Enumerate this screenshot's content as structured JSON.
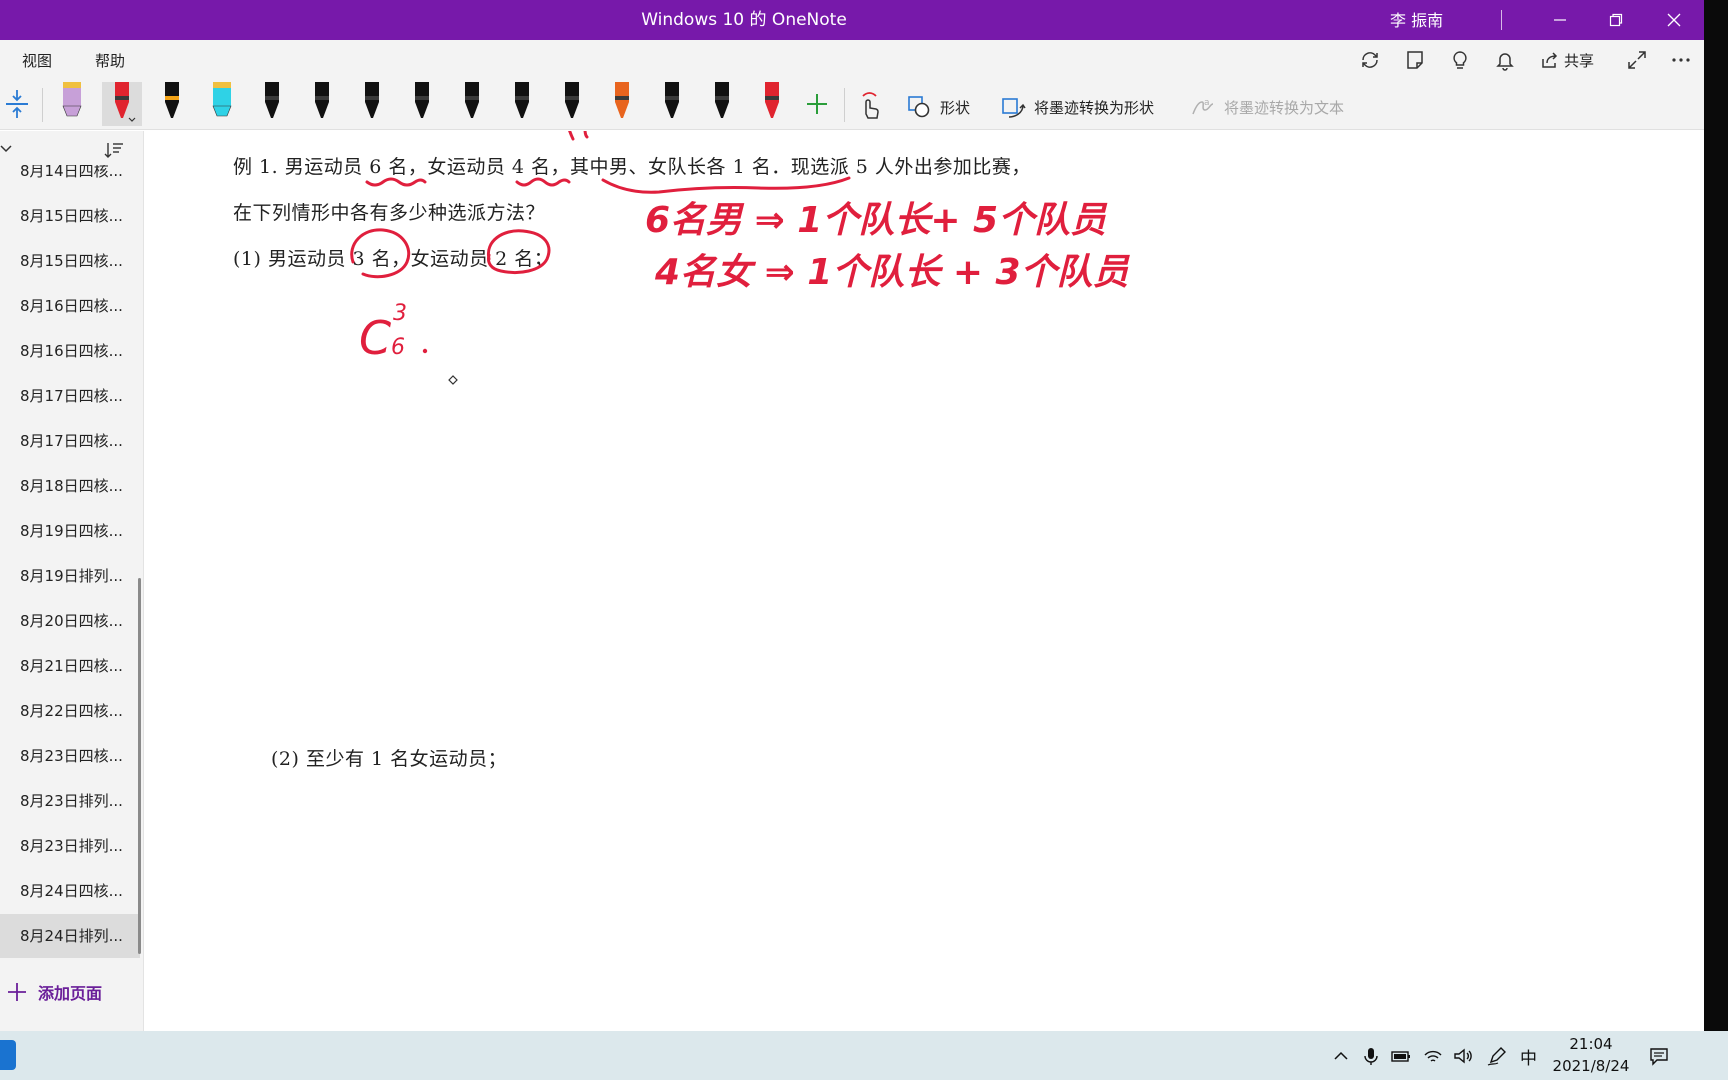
{
  "window": {
    "title": "Windows 10 的 OneNote",
    "user": "李 振南"
  },
  "menu": {
    "items": [
      "视图",
      "帮助"
    ],
    "share_label": "共享"
  },
  "toolbar": {
    "shapes_label": "形状",
    "ink_to_shape_label": "将墨迹转换为形状",
    "ink_to_text_label": "将墨迹转换为文本",
    "pens": [
      {
        "name": "highlighter-lavender",
        "color": "#c7a0d8"
      },
      {
        "name": "pen-red",
        "color": "#e0242f",
        "selected": true
      },
      {
        "name": "pen-black-rainbow",
        "color": "#111111"
      },
      {
        "name": "highlighter-cyan",
        "color": "#2fd2e6"
      },
      {
        "name": "pen-black-blue",
        "color": "#111111"
      },
      {
        "name": "pen-black-green",
        "color": "#111111"
      },
      {
        "name": "pen-black-orange",
        "color": "#111111"
      },
      {
        "name": "pen-black-lightblue",
        "color": "#111111"
      },
      {
        "name": "pen-black-1",
        "color": "#111111"
      },
      {
        "name": "pen-black-2",
        "color": "#111111"
      },
      {
        "name": "pen-black-3",
        "color": "#111111"
      },
      {
        "name": "pen-black-orange-galaxy",
        "color": "#e8641e"
      },
      {
        "name": "pen-black-4",
        "color": "#111111"
      },
      {
        "name": "pen-black-5",
        "color": "#111111"
      },
      {
        "name": "pen-red-2",
        "color": "#e0242f"
      }
    ]
  },
  "sidebar": {
    "pages": [
      {
        "label": "8月14日四核..."
      },
      {
        "label": "8月15日四核..."
      },
      {
        "label": "8月15日四核..."
      },
      {
        "label": "8月16日四核..."
      },
      {
        "label": "8月16日四核..."
      },
      {
        "label": "8月17日四核..."
      },
      {
        "label": "8月17日四核..."
      },
      {
        "label": "8月18日四核..."
      },
      {
        "label": "8月19日四核..."
      },
      {
        "label": "8月19日排列..."
      },
      {
        "label": "8月20日四核..."
      },
      {
        "label": "8月21日四核..."
      },
      {
        "label": "8月22日四核..."
      },
      {
        "label": "8月23日四核..."
      },
      {
        "label": "8月23日排列..."
      },
      {
        "label": "8月23日排列..."
      },
      {
        "label": "8月24日四核..."
      },
      {
        "label": "8月24日排列...",
        "selected": true
      }
    ],
    "add_page_label": "添加页面"
  },
  "page": {
    "line1": "例 1. 男运动员 6 名，女运动员 4 名，其中男、女队长各 1 名．现选派 5 人外出参加比赛，",
    "line2": "在下列情形中各有多少种选派方法？",
    "q1": "(1) 男运动员 3 名，女运动员 2 名；",
    "q2": "(2) 至少有 1 名女运动员；"
  },
  "ink": {
    "color": "#e01f3d",
    "note1": "6名男 ⇒ 1个队长+ 5个队员",
    "note2": "4名女 ⇒ 1个队长 + 3个队员",
    "formula_base": "C",
    "formula_sup": "3",
    "formula_sub": "6"
  },
  "taskbar": {
    "ime": "中",
    "time": "21:04",
    "date": "2021/8/24"
  },
  "colors": {
    "accent": "#7719aa",
    "add_page": "#6a1f99"
  }
}
